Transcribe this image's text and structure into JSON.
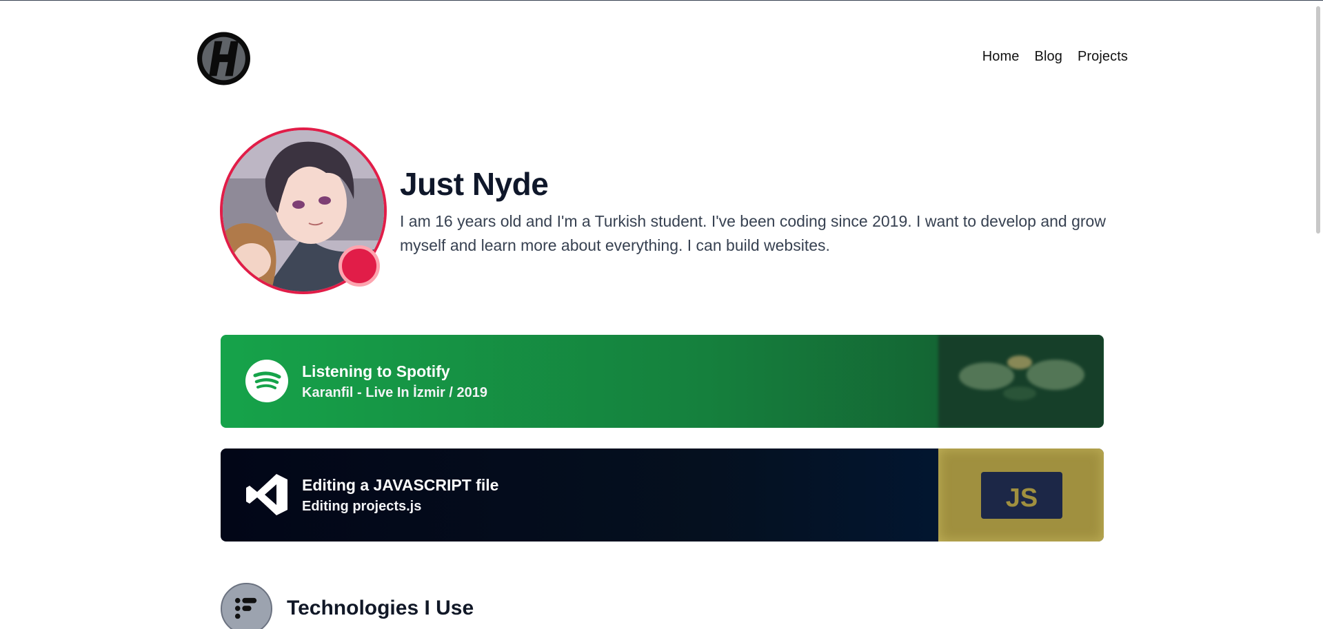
{
  "header": {
    "nav": [
      {
        "label": "Home"
      },
      {
        "label": "Blog"
      },
      {
        "label": "Projects"
      }
    ]
  },
  "profile": {
    "name": "Just Nyde",
    "bio": "I am 16 years old and I'm a Turkish student. I've been coding since 2019. I want to develop and grow myself and learn more about everything. I can build websites.",
    "status_color": "#e11d48"
  },
  "activities": [
    {
      "title": "Listening to Spotify",
      "subtitle": "Karanfil - Live In İzmir / 2019",
      "icon": "spotify-icon",
      "accent": "#16a34a"
    },
    {
      "title": "Editing a JAVASCRIPT file",
      "subtitle": "Editing projects.js",
      "icon": "vscode-icon",
      "accent": "#020617",
      "art_label": "JS"
    }
  ],
  "sections": {
    "technologies_title": "Technologies I Use"
  }
}
